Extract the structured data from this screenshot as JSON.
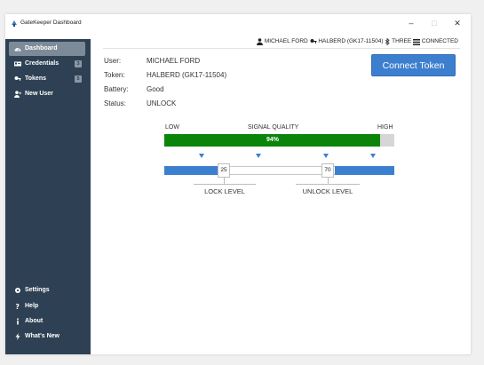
{
  "window": {
    "title": "GateKeeper Dashboard",
    "minimize": "–",
    "maximize": "□",
    "close": "✕"
  },
  "sidebar": {
    "items": [
      {
        "label": "Dashboard",
        "icon": "dashboard-icon",
        "active": true
      },
      {
        "label": "Credentials",
        "icon": "credentials-icon",
        "badge": "3"
      },
      {
        "label": "Tokens",
        "icon": "key-icon",
        "badge": "5"
      },
      {
        "label": "New User",
        "icon": "add-user-icon"
      }
    ],
    "bottom": [
      {
        "label": "Settings",
        "icon": "gear-icon"
      },
      {
        "label": "Help",
        "icon": "help-icon"
      },
      {
        "label": "About",
        "icon": "info-icon"
      },
      {
        "label": "What's New",
        "icon": "lightning-icon"
      }
    ]
  },
  "status": {
    "user": "MICHAEL FORD",
    "token": "HALBERD (GK17-11504)",
    "device": "THREE",
    "connection": "CONNECTED"
  },
  "info": {
    "user_label": "User:",
    "user_value": "MICHAEL FORD",
    "token_label": "Token:",
    "token_value": "HALBERD (GK17-11504)",
    "battery_label": "Battery:",
    "battery_value": "Good",
    "status_label": "Status:",
    "status_value": "UNLOCK"
  },
  "connect_button": "Connect Token",
  "signal": {
    "low_label": "LOW",
    "title": "SIGNAL QUALITY",
    "high_label": "HIGH",
    "value_text": "94%",
    "value": 94
  },
  "thresholds": {
    "lock_value": "25",
    "unlock_value": "70",
    "lock_label": "LOCK LEVEL",
    "unlock_label": "UNLOCK LEVEL"
  },
  "colors": {
    "sidebar": "#2e4154",
    "accent": "#3d7fcf",
    "signal": "#0a850a"
  }
}
